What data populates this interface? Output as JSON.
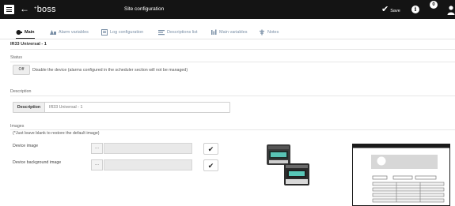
{
  "header": {
    "brand": "boss",
    "brand_prefix": "+",
    "title": "Site configuration",
    "save_label": "Save",
    "info_symbol": "i",
    "notifications_count": "0",
    "colors": {
      "bar": "#141414",
      "text": "#ffffff"
    }
  },
  "tabs": [
    {
      "label": "Main",
      "icon": "main-icon",
      "active": true
    },
    {
      "label": "Alarm variables",
      "icon": "alarm-variables-icon"
    },
    {
      "label": "Log configuration",
      "icon": "log-icon"
    },
    {
      "label": "Descriptions list",
      "icon": "list-icon"
    },
    {
      "label": "Main variables",
      "icon": "variables-icon"
    },
    {
      "label": "Notes",
      "icon": "notes-icon"
    }
  ],
  "device_name": "IR33 Universal - 1",
  "status": {
    "heading": "Status",
    "toggle_label": "Off",
    "text": "Disable the device (alarms configured in the scheduler section will not be managed)"
  },
  "description": {
    "heading": "Description",
    "field_label": "Description",
    "value": "IR33 Universal - 1"
  },
  "images": {
    "heading": "Images",
    "hint": "(*Just leave blank to restore the default image)",
    "device_image_label": "Device image",
    "device_background_label": "Device background image",
    "browse_label": "...",
    "device_image_value": "",
    "device_background_value": ""
  }
}
